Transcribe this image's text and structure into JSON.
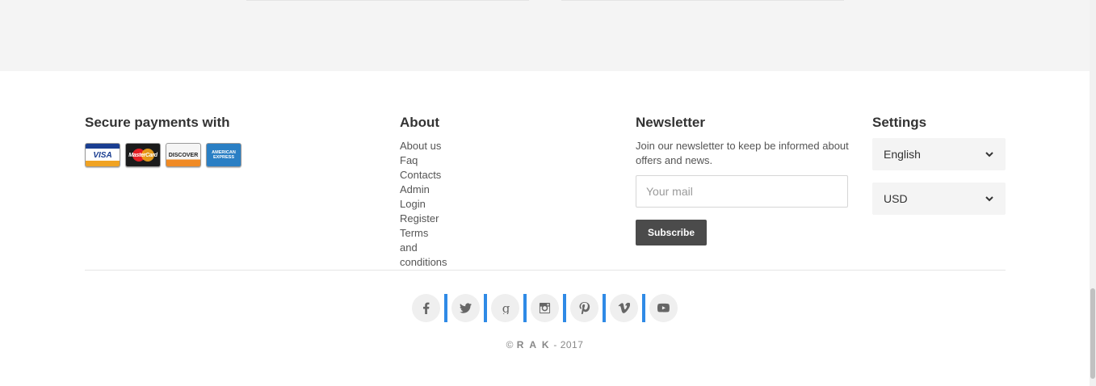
{
  "payments": {
    "title": "Secure payments with",
    "cards": [
      {
        "name": "VISA"
      },
      {
        "name": "MasterCard"
      },
      {
        "name": "DISCOVER"
      },
      {
        "name": "AMERICAN EXPRESS"
      }
    ]
  },
  "about": {
    "title": "About",
    "links": [
      "About us",
      "Faq",
      "Contacts",
      "Admin Login",
      "Register",
      "Terms and conditions"
    ]
  },
  "newsletter": {
    "title": "Newsletter",
    "text": "Join our newsletter to keep be informed about offers and news.",
    "placeholder": "Your mail",
    "button": "Subscribe"
  },
  "settings": {
    "title": "Settings",
    "language": "English",
    "currency": "USD"
  },
  "social": [
    "facebook-icon",
    "twitter-icon",
    "google-plus-icon",
    "instagram-icon",
    "pinterest-icon",
    "vimeo-icon",
    "youtube-icon"
  ],
  "footer": {
    "copyright_symbol": "©",
    "brand": "R A K",
    "year_suffix": " - 2017"
  },
  "colors": {
    "accent": "#2f8ae6",
    "button": "#4b4b4b",
    "band": "#f4f4f4"
  }
}
